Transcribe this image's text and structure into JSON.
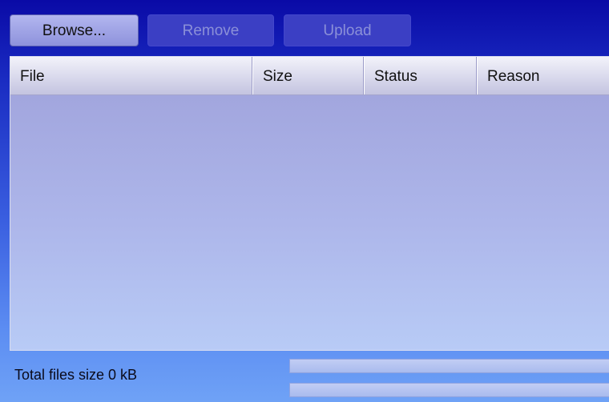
{
  "toolbar": {
    "browse_label": "Browse...",
    "remove_label": "Remove",
    "upload_label": "Upload"
  },
  "table": {
    "columns": [
      "File",
      "Size",
      "Status",
      "Reason"
    ],
    "rows": []
  },
  "footer": {
    "total_label": "Total files size 0 kB",
    "file_progress": 0,
    "total_progress": 0
  },
  "colors": {
    "background_top": "#0a0aa6",
    "background_bottom": "#6fa2f6",
    "button_enabled": "#b2b6ef",
    "button_disabled": "#3b3fc4",
    "list_area": "#a2a6de"
  }
}
